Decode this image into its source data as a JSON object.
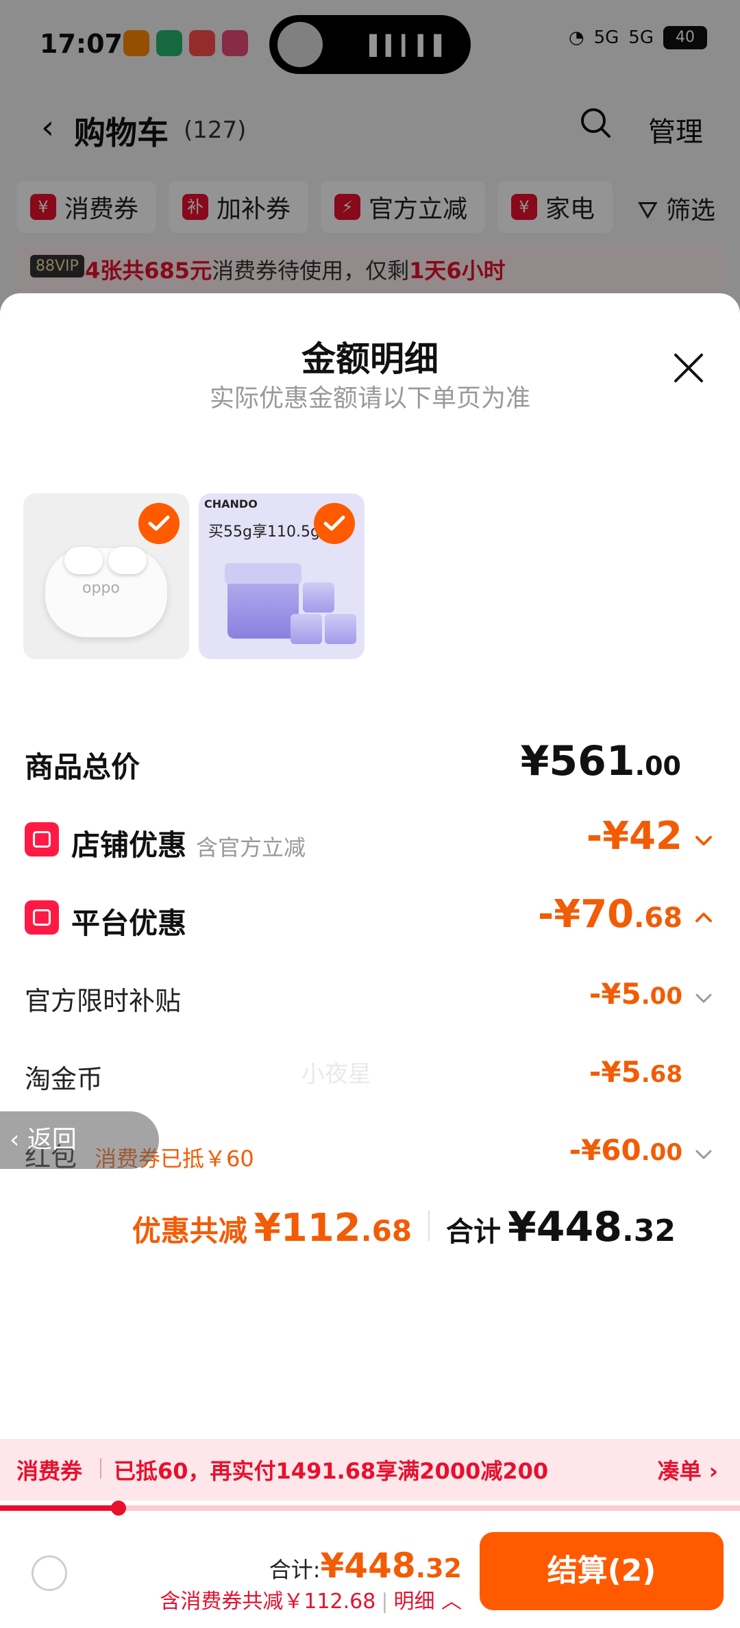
{
  "status_bar": {
    "time": "17:07",
    "network_1": "5G",
    "network_2": "5G",
    "battery": "40"
  },
  "nav": {
    "title": "购物车",
    "count": "(127)",
    "manage": "管理"
  },
  "chips": [
    {
      "icon": "¥",
      "label": "消费券"
    },
    {
      "icon": "补",
      "label": "加补券"
    },
    {
      "icon": "⚡",
      "label": "官方立减"
    },
    {
      "icon": "¥",
      "label": "家电"
    }
  ],
  "filter_label": "筛选",
  "vip_bar": {
    "tag": "88VIP",
    "highlight1": "4张共685元",
    "text": "消费券待使用，仅剩",
    "highlight2": "1天6小时"
  },
  "sheet": {
    "title": "金额明细",
    "subtitle": "实际优惠金额请以下单页为准",
    "products": [
      {
        "name": "oppo earbuds",
        "brand_text": "oppo"
      },
      {
        "name": "CHANDO cream",
        "brand_text": "CHANDO",
        "promo": "买55g享110.5g"
      }
    ],
    "total_price": {
      "label": "商品总价",
      "amount_int": "¥561",
      "amount_dec": ".00"
    },
    "shop_discount": {
      "label": "店铺优惠",
      "hint": "含官方立减",
      "amount": "-¥42"
    },
    "platform_discount": {
      "label": "平台优惠",
      "amount_int": "-¥70",
      "amount_dec": ".68"
    },
    "sub_items": [
      {
        "label": "官方限时补贴",
        "amount_int": "-¥5",
        "amount_dec": ".00",
        "expandable": true
      },
      {
        "label": "淘金币",
        "amount_int": "-¥5",
        "amount_dec": ".68",
        "expandable": false
      },
      {
        "label": "红包",
        "hint": "消费券已抵￥60",
        "amount_int": "-¥60",
        "amount_dec": ".00",
        "expandable": true
      }
    ],
    "summary": {
      "discount_label": "优惠共减",
      "discount_int": "¥112",
      "discount_dec": ".68",
      "total_label": "合计",
      "total_int": "¥448",
      "total_dec": ".32"
    },
    "watermark": "小夜星"
  },
  "back_float": "返回",
  "coupon_strip": {
    "label": "消费券",
    "text": "已抵60，再实付1491.68享满2000减200",
    "action": "凑单 ›",
    "progress": 0.16
  },
  "bottom": {
    "total_label": "合计:",
    "total_int": "¥448",
    "total_dec": ".32",
    "detail_text": "含消费券共减￥112.68",
    "detail_link": "明细",
    "checkout": "结算(2)"
  },
  "colors": {
    "accent": "#ff5a00",
    "red": "#e8102d",
    "discount_orange": "#f25c05"
  }
}
